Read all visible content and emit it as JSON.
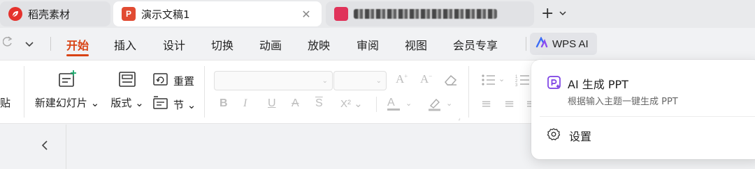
{
  "tabs": [
    {
      "title": "稻壳素材",
      "icon": "docer-icon",
      "icon_color": "#e5322d",
      "active": false
    },
    {
      "title": "演示文稿1",
      "icon": "presentation-icon",
      "icon_color": "#e14b32",
      "active": true,
      "close": "✕"
    },
    {
      "title": "",
      "icon": "document-icon",
      "icon_color": "#e0335a",
      "active": false
    }
  ],
  "tabbar": {
    "new_tab": "+",
    "dropdown": "⌄"
  },
  "menu": {
    "items": [
      "开始",
      "插入",
      "设计",
      "切换",
      "动画",
      "放映",
      "审阅",
      "视图",
      "会员专享"
    ],
    "active": "开始",
    "accent": "#d84315",
    "wps_ai": "WPS AI"
  },
  "ribbon": {
    "new_slide": "新建幻灯片",
    "layout": "版式",
    "reset": "重置",
    "section": "节",
    "format_buttons": [
      "B",
      "I",
      "U",
      "A",
      "S",
      "X²"
    ],
    "align_buttons": [
      "≡",
      "≡",
      "≡"
    ]
  },
  "popup": {
    "ai_ppt_title": "AI 生成 PPT",
    "ai_ppt_subtitle": "根据输入主题一键生成 PPT",
    "settings": "设置",
    "accent": "#7b3fe4"
  }
}
